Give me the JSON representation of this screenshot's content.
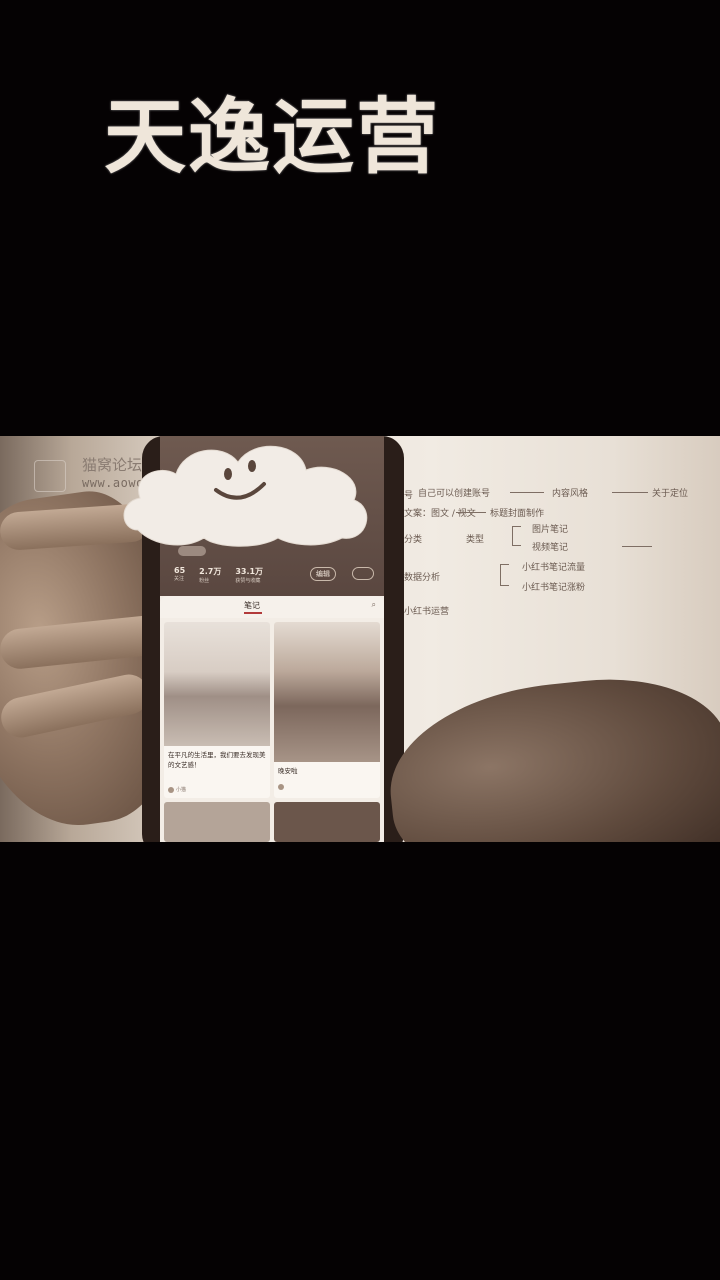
{
  "overlay": {
    "title": "天逸运营"
  },
  "watermark": {
    "name": "猫窝论坛",
    "url": "www.aowotao.com"
  },
  "sticker": {
    "icon": "smiley-cloud-icon"
  },
  "profile": {
    "stats": [
      {
        "value": "65",
        "label": "关注"
      },
      {
        "value": "2.7万",
        "label": "粉丝"
      },
      {
        "value": "33.1万",
        "label": "获赞与收藏"
      }
    ],
    "edit_label": "编辑"
  },
  "tabs": {
    "active": "笔记"
  },
  "cards": [
    {
      "title": "在平凡的生活里，我们要去发现美的文艺感！",
      "author": "小猫"
    },
    {
      "title": "晚安啦",
      "author": ""
    }
  ],
  "whiteboard": {
    "lines": [
      "自己可以创建账号",
      "内容风格",
      "关于定位",
      "图片笔记",
      "视频笔记",
      "图文 / 视文",
      "标题封面制作",
      "小红书笔记流量",
      "小红书笔记涨粉",
      "小红书运营"
    ]
  }
}
